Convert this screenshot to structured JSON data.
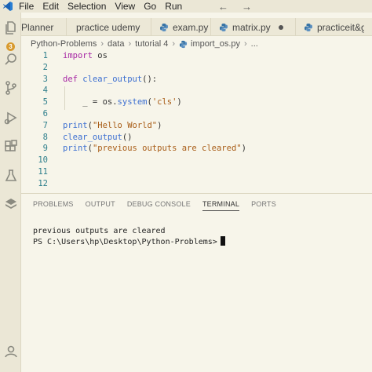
{
  "menubar": {
    "items": [
      "File",
      "Edit",
      "Selection",
      "View",
      "Go",
      "Run"
    ],
    "back_arrow": "←",
    "forward_arrow": "→"
  },
  "activitybar": {
    "source_control_badge": "3"
  },
  "tabs": [
    {
      "label": "Planner",
      "icon": "none"
    },
    {
      "label": "practice udemy",
      "icon": "none"
    },
    {
      "label": "exam.py",
      "icon": "python-icon"
    },
    {
      "label": "matrix.py",
      "icon": "python-icon",
      "modified": true
    },
    {
      "label": "practiceit&gem",
      "icon": "python-icon"
    }
  ],
  "breadcrumb": [
    "Python-Problems",
    "data",
    "tutorial 4",
    "import_os.py",
    "..."
  ],
  "editor": {
    "lines": [
      {
        "num": "1",
        "tokens": [
          [
            "kw",
            "import"
          ],
          [
            "plain",
            " os"
          ]
        ]
      },
      {
        "num": "2",
        "tokens": []
      },
      {
        "num": "3",
        "tokens": [
          [
            "kw",
            "def"
          ],
          [
            "plain",
            " "
          ],
          [
            "fn",
            "clear_output"
          ],
          [
            "plain",
            "():"
          ]
        ]
      },
      {
        "num": "4",
        "tokens": []
      },
      {
        "num": "5",
        "tokens": [
          [
            "plain",
            "    _ = os."
          ],
          [
            "fn",
            "system"
          ],
          [
            "plain",
            "("
          ],
          [
            "str",
            "'cls'"
          ],
          [
            "plain",
            ")"
          ]
        ]
      },
      {
        "num": "6",
        "tokens": []
      },
      {
        "num": "7",
        "tokens": [
          [
            "fn",
            "print"
          ],
          [
            "plain",
            "("
          ],
          [
            "str",
            "\"Hello World\""
          ],
          [
            "plain",
            ")"
          ]
        ]
      },
      {
        "num": "8",
        "tokens": [
          [
            "fn",
            "clear_output"
          ],
          [
            "plain",
            "()"
          ]
        ]
      },
      {
        "num": "9",
        "tokens": [
          [
            "fn",
            "print"
          ],
          [
            "plain",
            "("
          ],
          [
            "str",
            "\"previous outputs are cleared\""
          ],
          [
            "plain",
            ")"
          ]
        ]
      },
      {
        "num": "10",
        "tokens": []
      },
      {
        "num": "11",
        "tokens": []
      },
      {
        "num": "12",
        "tokens": []
      }
    ]
  },
  "panel": {
    "tabs": [
      "PROBLEMS",
      "OUTPUT",
      "DEBUG CONSOLE",
      "TERMINAL",
      "PORTS"
    ],
    "active_tab": "TERMINAL"
  },
  "terminal": {
    "output_line": "previous outputs are cleared",
    "prompt": "PS C:\\Users\\hp\\Desktop\\Python-Problems>"
  },
  "colors": {
    "keyword": "#a626a4",
    "function": "#3c6fd1",
    "string": "#a85c16",
    "line_number": "#2f7f8c",
    "badge": "#d89a2e",
    "python_blue": "#3572a5"
  }
}
